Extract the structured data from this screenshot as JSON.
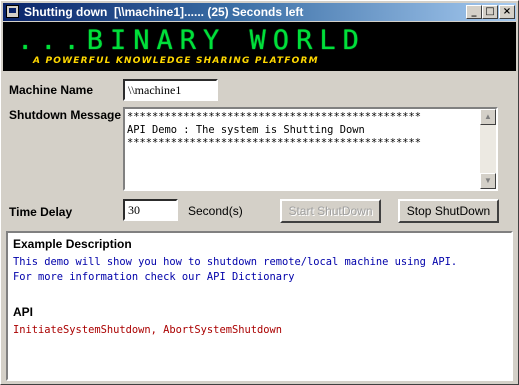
{
  "window": {
    "title": "Shutting down  [\\\\machine1]...... (25) Seconds left",
    "min_glyph": "_",
    "max_glyph": "□",
    "close_glyph": "×"
  },
  "banner": {
    "title": "...BINARY WORLD",
    "subtitle": "A POWERFUL KNOWLEDGE SHARING PLATFORM"
  },
  "form": {
    "machine_label": "Machine Name",
    "machine_value": "\\\\machine1",
    "message_label": "Shutdown Message",
    "message_lines": [
      "***********************************************",
      "API Demo : The system is Shutting Down",
      "***********************************************"
    ],
    "delay_label": "Time Delay",
    "delay_value": "30",
    "delay_unit": "Second(s)",
    "start_button": "Start ShutDown",
    "stop_button": "Stop ShutDown"
  },
  "description": {
    "heading": "Example Description",
    "line1": "This demo will show you how to shutdown remote/local machine using API.",
    "line2": "For more information check our API Dictionary",
    "api_heading": "API",
    "api_text": "InitiateSystemShutdown, AbortSystemShutdown"
  },
  "colors": {
    "banner_green": "#00e03a",
    "banner_yellow": "#ffd800",
    "description_blue": "#0000aa",
    "api_red": "#aa0000"
  },
  "icons": {
    "scroll_up": "▲",
    "scroll_down": "▼"
  }
}
